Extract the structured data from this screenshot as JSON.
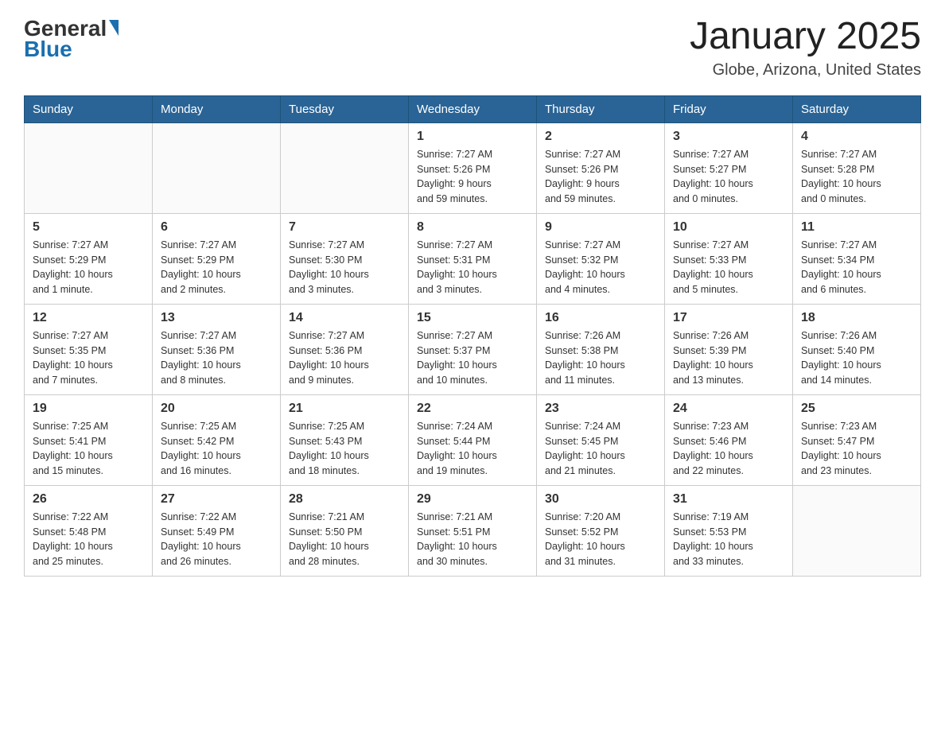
{
  "logo": {
    "general": "General",
    "blue": "Blue"
  },
  "title": "January 2025",
  "location": "Globe, Arizona, United States",
  "days_of_week": [
    "Sunday",
    "Monday",
    "Tuesday",
    "Wednesday",
    "Thursday",
    "Friday",
    "Saturday"
  ],
  "weeks": [
    [
      {
        "day": "",
        "info": ""
      },
      {
        "day": "",
        "info": ""
      },
      {
        "day": "",
        "info": ""
      },
      {
        "day": "1",
        "info": "Sunrise: 7:27 AM\nSunset: 5:26 PM\nDaylight: 9 hours\nand 59 minutes."
      },
      {
        "day": "2",
        "info": "Sunrise: 7:27 AM\nSunset: 5:26 PM\nDaylight: 9 hours\nand 59 minutes."
      },
      {
        "day": "3",
        "info": "Sunrise: 7:27 AM\nSunset: 5:27 PM\nDaylight: 10 hours\nand 0 minutes."
      },
      {
        "day": "4",
        "info": "Sunrise: 7:27 AM\nSunset: 5:28 PM\nDaylight: 10 hours\nand 0 minutes."
      }
    ],
    [
      {
        "day": "5",
        "info": "Sunrise: 7:27 AM\nSunset: 5:29 PM\nDaylight: 10 hours\nand 1 minute."
      },
      {
        "day": "6",
        "info": "Sunrise: 7:27 AM\nSunset: 5:29 PM\nDaylight: 10 hours\nand 2 minutes."
      },
      {
        "day": "7",
        "info": "Sunrise: 7:27 AM\nSunset: 5:30 PM\nDaylight: 10 hours\nand 3 minutes."
      },
      {
        "day": "8",
        "info": "Sunrise: 7:27 AM\nSunset: 5:31 PM\nDaylight: 10 hours\nand 3 minutes."
      },
      {
        "day": "9",
        "info": "Sunrise: 7:27 AM\nSunset: 5:32 PM\nDaylight: 10 hours\nand 4 minutes."
      },
      {
        "day": "10",
        "info": "Sunrise: 7:27 AM\nSunset: 5:33 PM\nDaylight: 10 hours\nand 5 minutes."
      },
      {
        "day": "11",
        "info": "Sunrise: 7:27 AM\nSunset: 5:34 PM\nDaylight: 10 hours\nand 6 minutes."
      }
    ],
    [
      {
        "day": "12",
        "info": "Sunrise: 7:27 AM\nSunset: 5:35 PM\nDaylight: 10 hours\nand 7 minutes."
      },
      {
        "day": "13",
        "info": "Sunrise: 7:27 AM\nSunset: 5:36 PM\nDaylight: 10 hours\nand 8 minutes."
      },
      {
        "day": "14",
        "info": "Sunrise: 7:27 AM\nSunset: 5:36 PM\nDaylight: 10 hours\nand 9 minutes."
      },
      {
        "day": "15",
        "info": "Sunrise: 7:27 AM\nSunset: 5:37 PM\nDaylight: 10 hours\nand 10 minutes."
      },
      {
        "day": "16",
        "info": "Sunrise: 7:26 AM\nSunset: 5:38 PM\nDaylight: 10 hours\nand 11 minutes."
      },
      {
        "day": "17",
        "info": "Sunrise: 7:26 AM\nSunset: 5:39 PM\nDaylight: 10 hours\nand 13 minutes."
      },
      {
        "day": "18",
        "info": "Sunrise: 7:26 AM\nSunset: 5:40 PM\nDaylight: 10 hours\nand 14 minutes."
      }
    ],
    [
      {
        "day": "19",
        "info": "Sunrise: 7:25 AM\nSunset: 5:41 PM\nDaylight: 10 hours\nand 15 minutes."
      },
      {
        "day": "20",
        "info": "Sunrise: 7:25 AM\nSunset: 5:42 PM\nDaylight: 10 hours\nand 16 minutes."
      },
      {
        "day": "21",
        "info": "Sunrise: 7:25 AM\nSunset: 5:43 PM\nDaylight: 10 hours\nand 18 minutes."
      },
      {
        "day": "22",
        "info": "Sunrise: 7:24 AM\nSunset: 5:44 PM\nDaylight: 10 hours\nand 19 minutes."
      },
      {
        "day": "23",
        "info": "Sunrise: 7:24 AM\nSunset: 5:45 PM\nDaylight: 10 hours\nand 21 minutes."
      },
      {
        "day": "24",
        "info": "Sunrise: 7:23 AM\nSunset: 5:46 PM\nDaylight: 10 hours\nand 22 minutes."
      },
      {
        "day": "25",
        "info": "Sunrise: 7:23 AM\nSunset: 5:47 PM\nDaylight: 10 hours\nand 23 minutes."
      }
    ],
    [
      {
        "day": "26",
        "info": "Sunrise: 7:22 AM\nSunset: 5:48 PM\nDaylight: 10 hours\nand 25 minutes."
      },
      {
        "day": "27",
        "info": "Sunrise: 7:22 AM\nSunset: 5:49 PM\nDaylight: 10 hours\nand 26 minutes."
      },
      {
        "day": "28",
        "info": "Sunrise: 7:21 AM\nSunset: 5:50 PM\nDaylight: 10 hours\nand 28 minutes."
      },
      {
        "day": "29",
        "info": "Sunrise: 7:21 AM\nSunset: 5:51 PM\nDaylight: 10 hours\nand 30 minutes."
      },
      {
        "day": "30",
        "info": "Sunrise: 7:20 AM\nSunset: 5:52 PM\nDaylight: 10 hours\nand 31 minutes."
      },
      {
        "day": "31",
        "info": "Sunrise: 7:19 AM\nSunset: 5:53 PM\nDaylight: 10 hours\nand 33 minutes."
      },
      {
        "day": "",
        "info": ""
      }
    ]
  ]
}
